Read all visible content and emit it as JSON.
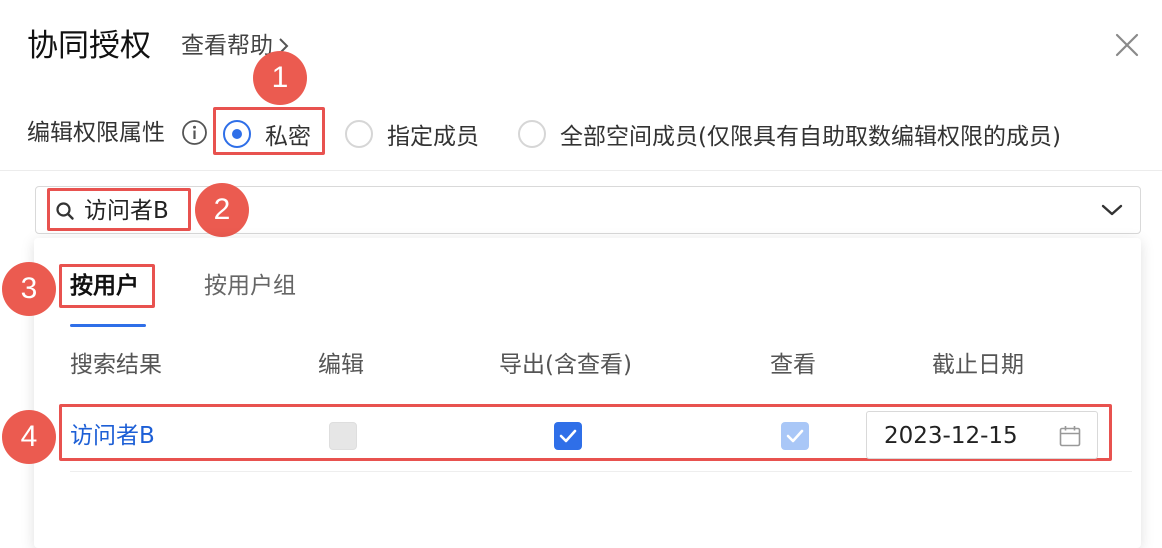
{
  "dialog": {
    "title": "协同授权",
    "help_link": "查看帮助"
  },
  "permission": {
    "label": "编辑权限属性",
    "options": [
      {
        "label": "私密",
        "checked": true
      },
      {
        "label": "指定成员",
        "checked": false
      },
      {
        "label": "全部空间成员(仅限具有自助取数编辑权限的成员)",
        "checked": false
      }
    ]
  },
  "search": {
    "value": "访问者B"
  },
  "tabs": [
    {
      "label": "按用户",
      "active": true
    },
    {
      "label": "按用户组",
      "active": false
    }
  ],
  "table": {
    "columns": [
      "搜索结果",
      "编辑",
      "导出(含查看)",
      "查看",
      "截止日期"
    ],
    "rows": [
      {
        "name": "访问者B",
        "edit": "disabled-unchecked",
        "export": "checked",
        "view": "checked-disabled",
        "deadline": "2023-12-15"
      }
    ]
  },
  "annotations": [
    "1",
    "2",
    "3",
    "4"
  ],
  "colors": {
    "accent": "#2f6fe8",
    "annotation_red": "#e8524f",
    "link_blue": "#1d5fd6"
  }
}
